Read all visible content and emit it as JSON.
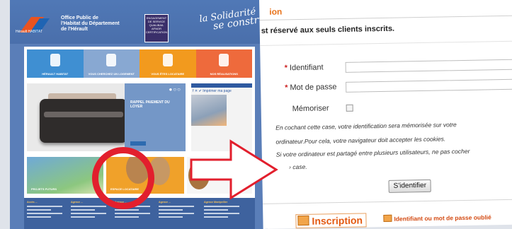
{
  "website": {
    "org_name_lines": [
      "Office Public de",
      "l'Habitat du Département",
      "de l'Hérault"
    ],
    "logo_text": "Hérault HABITAT",
    "badge_lines": [
      "ENGAGEMENT",
      "DE SERVICE",
      "QUALIBAIL",
      "AFNOR CERTIFICATION"
    ],
    "slogan_lines": [
      "la Solidarité",
      "se construit"
    ],
    "nav": [
      {
        "label": "HÉRAULT HABITAT",
        "color": "#3f8fd2"
      },
      {
        "label": "VOUS CHERCHEZ UN LOGEMENT",
        "color": "#88a8d2"
      },
      {
        "label": "VOUS ÊTES LOCATAIRE",
        "color": "#f29a1e"
      },
      {
        "label": "NOS RÉALISATIONS",
        "color": "#ee6a3c"
      }
    ],
    "carousel_dots": "●○○",
    "promo_title": "RAPPEL PAIEMENT DU LOYER",
    "social_bar": "f  ☀  ✔  Imprimer ma page",
    "tile_projects": "PROJETS FUTURS",
    "tile_tenant": "ESPACE LOCATAIRE",
    "footer_columns": [
      "Accès ...",
      "Agence ...",
      "Agence ...",
      "Agence ...",
      "Agence Montpellier"
    ]
  },
  "login": {
    "title": "ion",
    "intro": "st réservé aux seuls clients inscrits.",
    "required_mark": "*",
    "username_label": "Identifiant",
    "password_label": "Mot de passe",
    "remember_label": "Mémoriser",
    "help_lines": [
      "En cochant cette case, votre identification sera mémorisée sur votre",
      "ordinateur.Pour cela, votre navigateur doit accepter les cookies.",
      "Si votre ordinateur est partagé entre plusieurs utilisateurs, ne pas cocher",
      "› case."
    ],
    "submit_label": "S'identifier",
    "register_label": "Inscription",
    "forgot_label": "Identifiant ou mot de passe oublié"
  },
  "colors": {
    "accent_orange": "#e8731b",
    "highlight_red": "#e21f2d",
    "site_blue": "#5a7eb8"
  }
}
